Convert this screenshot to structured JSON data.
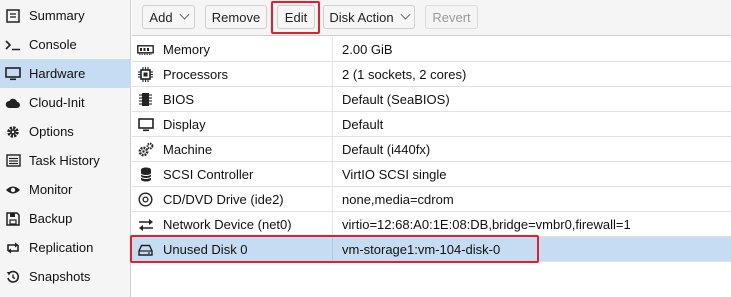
{
  "sidebar": {
    "items": [
      {
        "label": "Summary",
        "icon": "summary-icon"
      },
      {
        "label": "Console",
        "icon": "console-icon"
      },
      {
        "label": "Hardware",
        "icon": "monitor-icon",
        "active": true
      },
      {
        "label": "Cloud-Init",
        "icon": "cloud-icon"
      },
      {
        "label": "Options",
        "icon": "gear-icon"
      },
      {
        "label": "Task History",
        "icon": "list-icon"
      },
      {
        "label": "Monitor",
        "icon": "eye-icon"
      },
      {
        "label": "Backup",
        "icon": "floppy-icon"
      },
      {
        "label": "Replication",
        "icon": "retweet-icon"
      },
      {
        "label": "Snapshots",
        "icon": "history-icon"
      }
    ]
  },
  "toolbar": {
    "add_label": "Add",
    "remove_label": "Remove",
    "edit_label": "Edit",
    "disk_action_label": "Disk Action",
    "revert_label": "Revert"
  },
  "hardware": {
    "rows": [
      {
        "key": "Memory",
        "value": "2.00 GiB",
        "icon": "memory-icon"
      },
      {
        "key": "Processors",
        "value": "2 (1 sockets, 2 cores)",
        "icon": "cpu-icon"
      },
      {
        "key": "BIOS",
        "value": "Default (SeaBIOS)",
        "icon": "microchip-icon"
      },
      {
        "key": "Display",
        "value": "Default",
        "icon": "desktop-icon"
      },
      {
        "key": "Machine",
        "value": "Default (i440fx)",
        "icon": "cogs-icon"
      },
      {
        "key": "SCSI Controller",
        "value": "VirtIO SCSI single",
        "icon": "database-icon"
      },
      {
        "key": "CD/DVD Drive (ide2)",
        "value": "none,media=cdrom",
        "icon": "cdrom-icon"
      },
      {
        "key": "Network Device (net0)",
        "value": "virtio=12:68:A0:1E:08:DB,bridge=vmbr0,firewall=1",
        "icon": "exchange-icon"
      },
      {
        "key": "Unused Disk 0",
        "value": "vm-storage1:vm-104-disk-0",
        "icon": "hdd-icon",
        "selected": true
      }
    ]
  },
  "colors": {
    "selection": "#c5dcf2",
    "highlight_box": "#e0202f"
  }
}
